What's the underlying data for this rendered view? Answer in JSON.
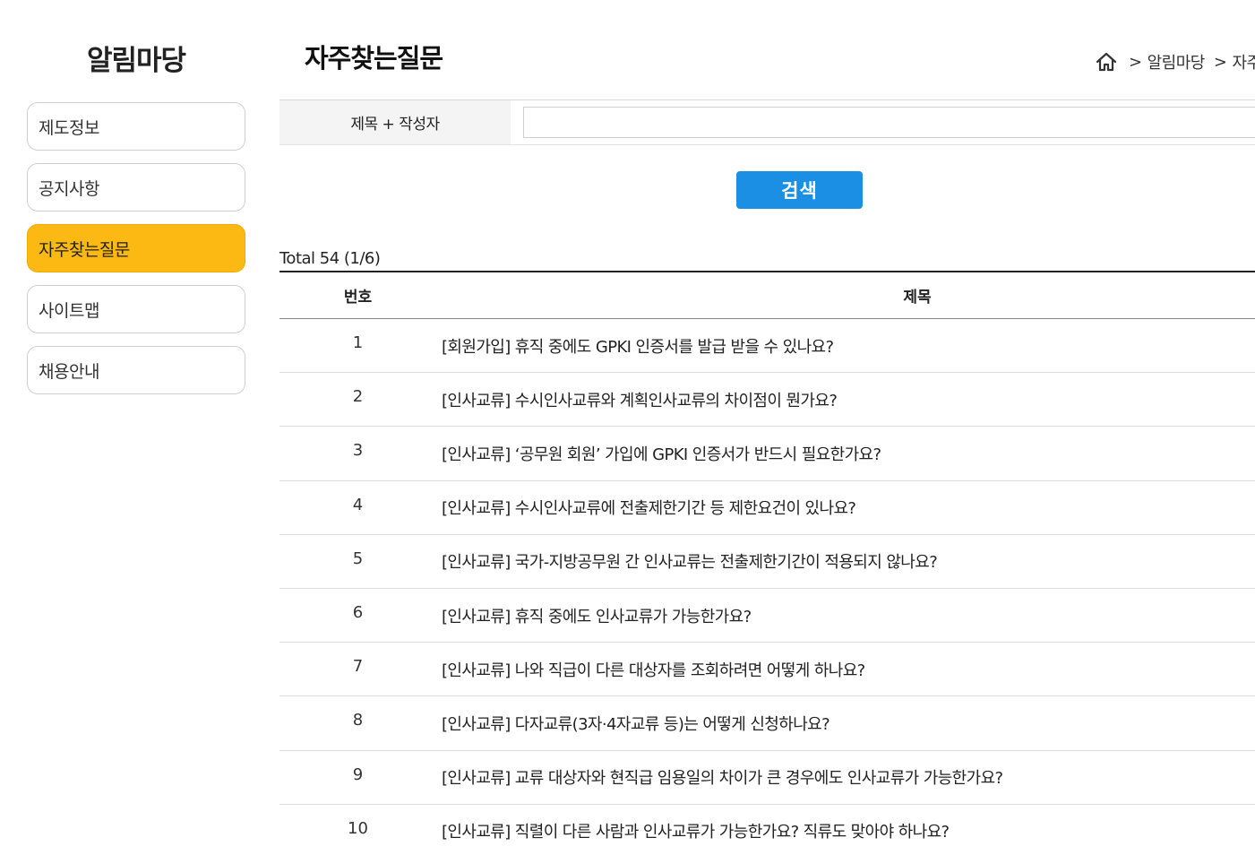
{
  "sidebar": {
    "title": "알림마당",
    "items": [
      {
        "label": "제도정보",
        "active": false
      },
      {
        "label": "공지사항",
        "active": false
      },
      {
        "label": "자주찾는질문",
        "active": true
      },
      {
        "label": "사이트맵",
        "active": false
      },
      {
        "label": "채용안내",
        "active": false
      }
    ]
  },
  "header": {
    "title": "자주찾는질문",
    "breadcrumb": [
      {
        "label": "알림마당"
      },
      {
        "label": "자주"
      }
    ],
    "breadcrumb_separator": ">"
  },
  "search": {
    "label": "제목 + 작성자",
    "value": "",
    "button_label": "검색"
  },
  "list": {
    "total_text": "Total 54 (1/6)",
    "columns": {
      "number": "번호",
      "title": "제목"
    },
    "rows": [
      {
        "number": "1",
        "title": "[회원가입] 휴직 중에도 GPKI 인증서를 발급 받을 수 있나요?"
      },
      {
        "number": "2",
        "title": "[인사교류] 수시인사교류와 계획인사교류의 차이점이 뭔가요?"
      },
      {
        "number": "3",
        "title": "[인사교류] ‘공무원 회원’ 가입에 GPKI 인증서가 반드시 필요한가요?"
      },
      {
        "number": "4",
        "title": "[인사교류] 수시인사교류에 전출제한기간 등 제한요건이 있나요?"
      },
      {
        "number": "5",
        "title": "[인사교류] 국가-지방공무원 간 인사교류는 전출제한기간이 적용되지 않나요?"
      },
      {
        "number": "6",
        "title": "[인사교류] 휴직 중에도 인사교류가 가능한가요?"
      },
      {
        "number": "7",
        "title": "[인사교류] 나와 직급이 다른 대상자를 조회하려면 어떻게 하나요?"
      },
      {
        "number": "8",
        "title": "[인사교류] 다자교류(3자·4자교류 등)는 어떻게 신청하나요?"
      },
      {
        "number": "9",
        "title": "[인사교류] 교류 대상자와 현직급 임용일의 차이가 큰 경우에도 인사교류가 가능한가요?"
      },
      {
        "number": "10",
        "title": "[인사교류] 직렬이 다른 사람과 인사교류가 가능한가요? 직류도 맞아야 하나요?"
      }
    ]
  },
  "colors": {
    "active_menu": "#fdb913",
    "search_button": "#1a8fe3"
  },
  "icons": {
    "home": "home-icon"
  }
}
